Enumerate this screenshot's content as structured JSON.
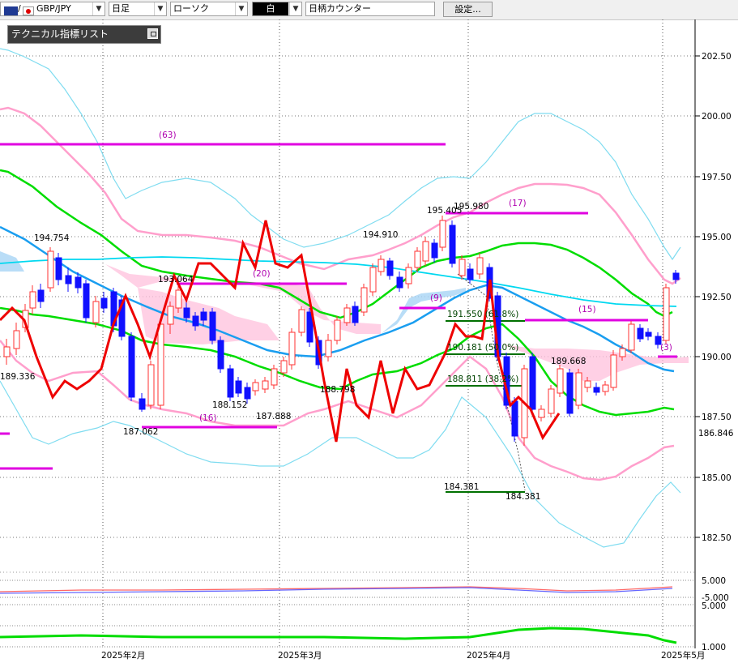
{
  "toolbar": {
    "symbol": "GBP/JPY",
    "timeframe": "日足",
    "chart_style": "ローソク",
    "color_mode": "白",
    "counter": "日柄カウンター",
    "settings_button": "設定..."
  },
  "indicator_panel": {
    "title": "テクニカル指標リスト"
  },
  "colors": {
    "bull": "#ff3030",
    "bear": "#1010ff",
    "spanA": "#1a7fd1",
    "spanB": "#ffb0d0",
    "ma_fast": "#00c8f0",
    "ma_mid": "#1a9ef0",
    "ma_slow": "#00dd00",
    "bands_outer": "#7fdcf0",
    "bands_inner": "#ff9fcc",
    "zone_line": "#e000e0",
    "rsi": "#ee0000",
    "fib": "#007000"
  },
  "chart_data": {
    "type": "candlestick",
    "y_axis_ticks": [
      "202.50",
      "200.00",
      "197.50",
      "195.00",
      "192.50",
      "190.00",
      "187.50",
      "185.00",
      "182.50"
    ],
    "ylim": [
      181.5,
      204.0
    ],
    "current_price": "186.846",
    "x_axis_ticks": [
      "2025年2月",
      "2025年3月",
      "2025年4月",
      "2025年5月"
    ],
    "price_labels": [
      "194.754",
      "193.064",
      "189.336",
      "187.062",
      "188.152",
      "187.888",
      "188.798",
      "194.910",
      "195.405",
      "195.980",
      "189.668",
      "184.381",
      "184.381"
    ],
    "zone_labels": [
      "(63)",
      "(20)",
      "(16)",
      "(9)",
      "(17)",
      "(15)",
      "(3)"
    ],
    "fib_labels": [
      "191.550 (61.8%)",
      "190.181 (50.0%)",
      "188.811 (38.2%)"
    ],
    "oscillator1_ticks": [
      "5.000",
      "-5.000"
    ],
    "oscillator2_ticks": [
      "5.000",
      "1.000"
    ]
  }
}
